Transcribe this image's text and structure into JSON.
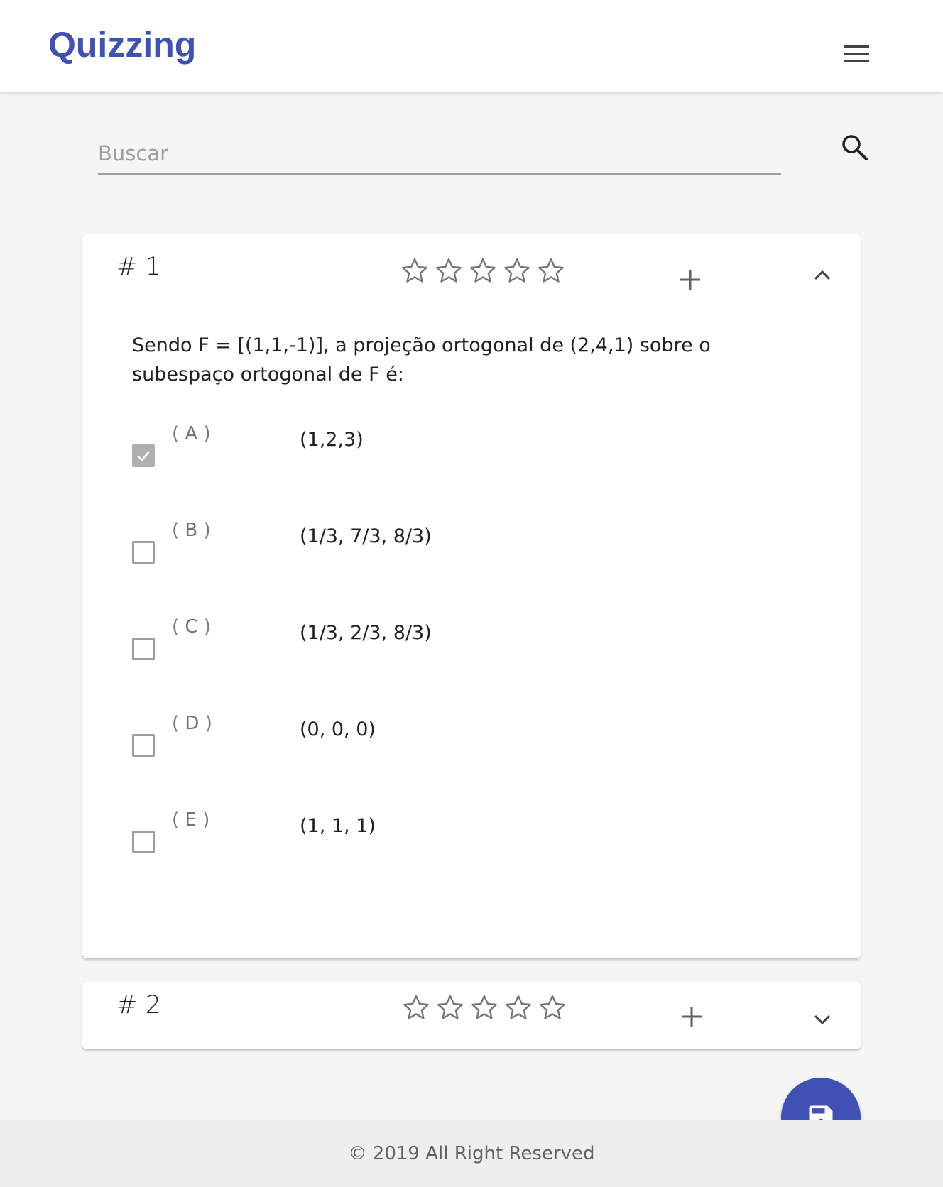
{
  "header": {
    "brand": "Quizzing",
    "menu_icon": "hamburger-menu-icon"
  },
  "search": {
    "placeholder": "Buscar",
    "value": "",
    "icon": "search-icon"
  },
  "questions": [
    {
      "number": "# 1",
      "rating": 0,
      "rating_max": 5,
      "expanded": true,
      "text": "Sendo F = [(1,1,-1)], a projeção ortogonal de (2,4,1) sobre o subespaço ortogonal de F é:",
      "options": [
        {
          "letter": "( A )",
          "text": "(1,2,3)",
          "checked": true
        },
        {
          "letter": "( B )",
          "text": "(1/3, 7/3, 8/3)",
          "checked": false
        },
        {
          "letter": "( C )",
          "text": "(1/3, 2/3, 8/3)",
          "checked": false
        },
        {
          "letter": "( D )",
          "text": "(0, 0, 0)",
          "checked": false
        },
        {
          "letter": "( E )",
          "text": "(1, 1, 1)",
          "checked": false
        }
      ]
    },
    {
      "number": "# 2",
      "rating": 0,
      "rating_max": 5,
      "expanded": false
    }
  ],
  "fab": {
    "icon": "save-icon"
  },
  "footer": {
    "text": "© 2019 All Right Reserved"
  },
  "colors": {
    "primary": "#3f51b5",
    "background": "#f5f5f5",
    "checked": "#b0b0b0"
  }
}
